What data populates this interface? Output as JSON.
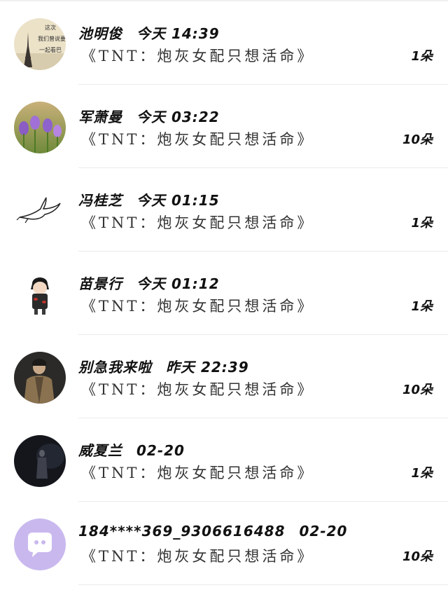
{
  "conversations": [
    {
      "name": "池明俊",
      "time": "今天 14:39",
      "preview": "《TNT：炮灰女配只想活命》",
      "count": "1朵",
      "avatar_icon": "eiffel-tower-photo-icon",
      "avatar_texts": [
        "这次",
        "我们曾说要",
        "一起看巴"
      ]
    },
    {
      "name": "军萧曼",
      "time": "今天 03:22",
      "preview": "《TNT：炮灰女配只想活命》",
      "count": "10朵",
      "avatar_icon": "purple-flowers-photo-icon"
    },
    {
      "name": "冯桂芝",
      "time": "今天 01:15",
      "preview": "《TNT：炮灰女配只想活命》",
      "count": "1朵",
      "avatar_icon": "dove-sketch-icon"
    },
    {
      "name": "苗景行",
      "time": "今天 01:12",
      "preview": "《TNT：炮灰女配只想活命》",
      "count": "1朵",
      "avatar_icon": "anime-character-icon"
    },
    {
      "name": "别急我来啦",
      "time": "昨天 22:39",
      "preview": "《TNT：炮灰女配只想活命》",
      "count": "10朵",
      "avatar_icon": "man-in-coat-photo-icon"
    },
    {
      "name": "威夏兰",
      "time": "02-20",
      "preview": "《TNT：炮灰女配只想活命》",
      "count": "1朵",
      "avatar_icon": "dark-figure-photo-icon"
    },
    {
      "name": "184****369_9306616488",
      "time": "02-20",
      "preview": "《TNT：炮灰女配只想活命》",
      "count": "10朵",
      "avatar_icon": "default-chat-avatar-icon"
    }
  ],
  "colors": {
    "default_avatar_bg": "#c9b8ee",
    "text_primary": "#111111",
    "divider": "#ececec"
  }
}
